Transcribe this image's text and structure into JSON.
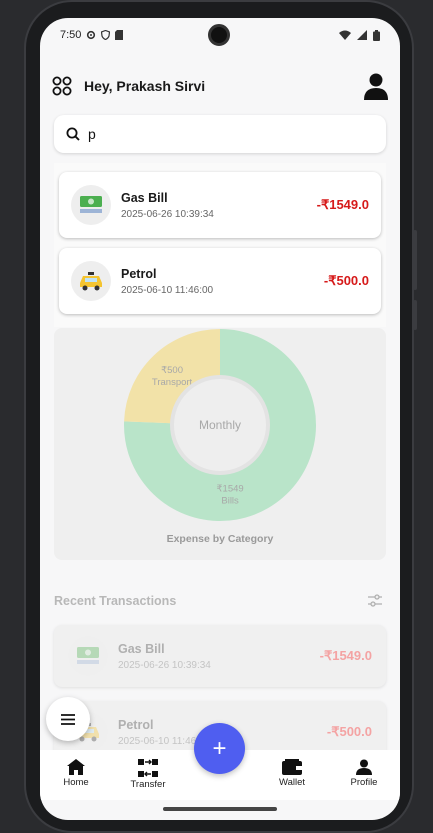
{
  "status_bar": {
    "time": "7:50"
  },
  "header": {
    "greeting": "Hey, Prakash Sirvi"
  },
  "search": {
    "value": "p"
  },
  "search_results": [
    {
      "title": "Gas Bill",
      "date": "2025-06-26 10:39:34",
      "amount": "-₹1549.0",
      "icon": "cash-icon"
    },
    {
      "title": "Petrol",
      "date": "2025-06-10 11:46:00",
      "amount": "-₹500.0",
      "icon": "taxi-icon"
    }
  ],
  "chart_data": {
    "type": "pie",
    "title": "Expense by Category",
    "center_label": "Monthly",
    "slices": [
      {
        "label": "Bills",
        "value": 1549,
        "value_label": "₹1549",
        "color": "#b9e4c9"
      },
      {
        "label": "Transport",
        "value": 500,
        "value_label": "₹500",
        "color": "#f2e2a8"
      }
    ]
  },
  "recent": {
    "title": "Recent Transactions",
    "items": [
      {
        "title": "Gas Bill",
        "date": "2025-06-26 10:39:34",
        "amount": "-₹1549.0"
      },
      {
        "title": "Petrol",
        "date": "2025-06-10 11:46:00",
        "amount": "-₹500.0"
      }
    ]
  },
  "bottom_nav": [
    {
      "label": "Home",
      "icon": "home-icon"
    },
    {
      "label": "Transfer",
      "icon": "transfer-icon"
    },
    {
      "label": "",
      "icon": ""
    },
    {
      "label": "Wallet",
      "icon": "wallet-icon"
    },
    {
      "label": "Profile",
      "icon": "profile-icon"
    }
  ],
  "fab": {
    "add_symbol": "+"
  },
  "colors": {
    "accent": "#4f5ef0",
    "expense": "#d61a1a"
  }
}
